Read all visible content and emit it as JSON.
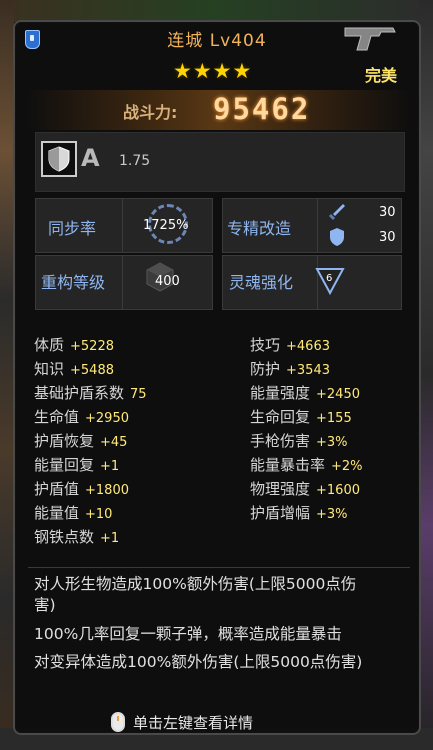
{
  "tooltip": {
    "title": "连城 Lv404",
    "stars": "★★★★",
    "quality": "完美",
    "power_label": "战斗力:",
    "power_value": "95462",
    "grade_letter": "A",
    "grade_value": "1.75",
    "sync_label": "同步率",
    "sync_value": "1725%",
    "spec_label": "专精改造",
    "spec_attack": "30",
    "spec_defense": "30",
    "rebuild_label": "重构等级",
    "rebuild_value": "400",
    "soul_label": "灵魂强化",
    "soul_value": "6",
    "left_attrs": [
      {
        "name": "体质",
        "value": "+5228"
      },
      {
        "name": "知识",
        "value": "+5488"
      },
      {
        "name": "基础护盾系数",
        "value": "75"
      },
      {
        "name": "生命值",
        "value": "+2950"
      },
      {
        "name": "护盾恢复",
        "value": "+45"
      },
      {
        "name": "能量回复",
        "value": "+1"
      },
      {
        "name": "护盾值",
        "value": "+1800"
      },
      {
        "name": "能量值",
        "value": "+10"
      },
      {
        "name": "钢铁点数",
        "value": "+1"
      }
    ],
    "right_attrs": [
      {
        "name": "技巧",
        "value": "+4663"
      },
      {
        "name": "防护",
        "value": "+3543"
      },
      {
        "name": "能量强度",
        "value": "+2450"
      },
      {
        "name": "生命回复",
        "value": "+155"
      },
      {
        "name": "手枪伤害",
        "value": "+3%"
      },
      {
        "name": "能量暴击率",
        "value": "+2%"
      },
      {
        "name": "物理强度",
        "value": "+1600"
      },
      {
        "name": "护盾增幅",
        "value": "+3%"
      }
    ],
    "desc": [
      "对人形生物造成100%额外伤害(上限5000点伤",
      "害)",
      "100%几率回复一颗子弹，概率造成能量暴击",
      "对变异体造成100%额外伤害(上限5000点伤害)"
    ],
    "hint": "单击左键查看详情"
  },
  "colors": {
    "title": "#f2b25c",
    "stars": "#ffd400",
    "quality": "#ffe566",
    "label_blue": "#8fb6f0",
    "value_yellow": "#ffe97a"
  },
  "icons": [
    "badge-icon",
    "pistol-icon",
    "shield-icon",
    "sync-ring-icon",
    "sword-icon",
    "shield-small-icon",
    "cube-icon",
    "soul-triangle-icon",
    "mouse-icon"
  ]
}
